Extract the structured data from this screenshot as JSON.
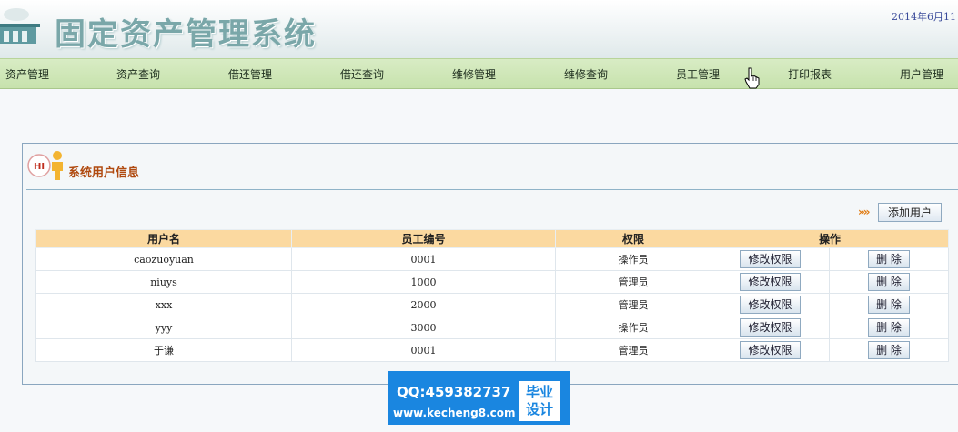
{
  "header": {
    "title": "固定资产管理系统",
    "date": "2014年6月11"
  },
  "nav": {
    "items": [
      {
        "label": "资产管理"
      },
      {
        "label": "资产查询"
      },
      {
        "label": "借还管理"
      },
      {
        "label": "借还查询"
      },
      {
        "label": "维修管理"
      },
      {
        "label": "维修查询"
      },
      {
        "label": "员工管理"
      },
      {
        "label": "打印报表"
      },
      {
        "label": "用户管理"
      }
    ]
  },
  "panel": {
    "badge": "HI",
    "title": "系统用户信息",
    "add_button": "添加用户"
  },
  "table": {
    "headers": [
      "用户名",
      "员工编号",
      "权限",
      "操作"
    ],
    "edit_label": "修改权限",
    "delete_label": "删 除",
    "rows": [
      {
        "username": "caozuoyuan",
        "emp_no": "0001",
        "role": "操作员"
      },
      {
        "username": "niuys",
        "emp_no": "1000",
        "role": "管理员"
      },
      {
        "username": "xxx",
        "emp_no": "2000",
        "role": "管理员"
      },
      {
        "username": "yyy",
        "emp_no": "3000",
        "role": "操作员"
      },
      {
        "username": "于谦",
        "emp_no": "0001",
        "role": "管理员"
      }
    ]
  },
  "watermark": {
    "qq": "QQ:459382737",
    "url": "www.kecheng8.com",
    "tag_line1": "毕业",
    "tag_line2": "设计"
  },
  "colors": {
    "nav_bg": "#c7e2ad",
    "table_header_bg": "#fbd9a0",
    "title_color": "#b04a10",
    "watermark_bg": "#1a86e0"
  }
}
